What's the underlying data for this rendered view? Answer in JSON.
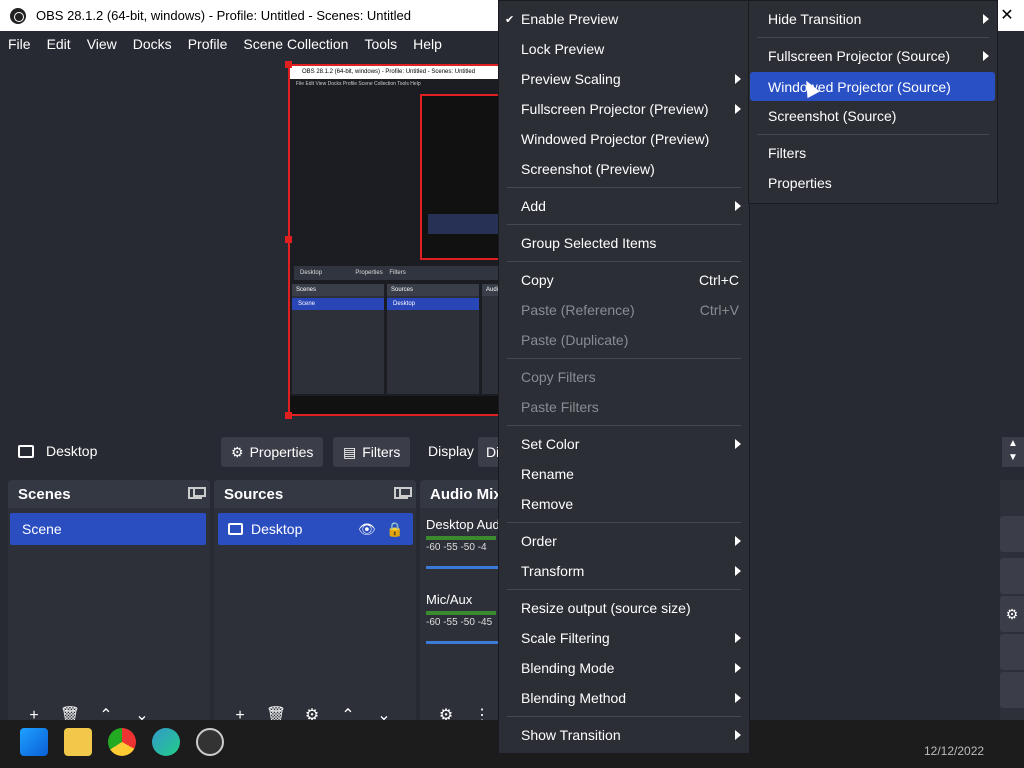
{
  "window": {
    "title": "OBS 28.1.2 (64-bit, windows) - Profile: Untitled - Scenes: Untitled",
    "close": "✕"
  },
  "menubar": [
    "File",
    "Edit",
    "View",
    "Docks",
    "Profile",
    "Scene Collection",
    "Tools",
    "Help"
  ],
  "preview": {
    "nested_title": "OBS 28.1.2 (64-bit, windows) - Profile: Untitled - Scenes: Untitled",
    "nested_menu": "File  Edit  View  Docks  Profile  Scene Collection  Tools  Help",
    "nested_source": "Desktop",
    "nested_properties": "Properties",
    "nested_filters": "Filters",
    "nested_scenes": "Scenes",
    "nested_scene": "Scene",
    "nested_sources": "Sources",
    "nested_desktop": "Desktop",
    "nested_audio": "Audi"
  },
  "sourcebar": {
    "source_name": "Desktop",
    "properties": "Properties",
    "filters": "Filters",
    "display": "Display",
    "display_value": "Di"
  },
  "scenes": {
    "header": "Scenes",
    "items": [
      "Scene"
    ]
  },
  "sources": {
    "header": "Sources",
    "items": [
      "Desktop"
    ]
  },
  "mixer": {
    "header": "Audio Mix",
    "channels": [
      {
        "name": "Desktop Aud",
        "scale": "-60  -55  -50  -4"
      },
      {
        "name": "Mic/Aux",
        "scale": "-60  -55  -50  -45"
      }
    ]
  },
  "taskbar": {
    "clock": "12/12/2022"
  },
  "context_menu": {
    "items": [
      {
        "label": "Enable Preview",
        "checked": true
      },
      {
        "label": "Lock Preview"
      },
      {
        "label": "Preview Scaling",
        "submenu": true
      },
      {
        "label": "Fullscreen Projector (Preview)",
        "submenu": true
      },
      {
        "label": "Windowed Projector (Preview)"
      },
      {
        "label": "Screenshot (Preview)"
      },
      {
        "label": "Add",
        "submenu": true
      },
      {
        "label": "Group Selected Items"
      },
      {
        "label": "Copy",
        "shortcut": "Ctrl+C"
      },
      {
        "label": "Paste (Reference)",
        "shortcut": "Ctrl+V",
        "disabled": true
      },
      {
        "label": "Paste (Duplicate)",
        "disabled": true
      },
      {
        "label": "Copy Filters",
        "disabled": true
      },
      {
        "label": "Paste Filters",
        "disabled": true
      },
      {
        "label": "Set Color",
        "submenu": true
      },
      {
        "label": "Rename"
      },
      {
        "label": "Remove"
      },
      {
        "label": "Order",
        "submenu": true
      },
      {
        "label": "Transform",
        "submenu": true
      },
      {
        "label": "Resize output (source size)"
      },
      {
        "label": "Scale Filtering",
        "submenu": true
      },
      {
        "label": "Blending Mode",
        "submenu": true
      },
      {
        "label": "Blending Method",
        "submenu": true
      },
      {
        "label": "Show Transition",
        "submenu": true
      }
    ]
  },
  "submenu": {
    "items": [
      {
        "label": "Hide Transition",
        "submenu": true
      },
      {
        "label": "Fullscreen Projector (Source)",
        "submenu": true
      },
      {
        "label": "Windowed Projector (Source)",
        "highlighted": true
      },
      {
        "label": "Screenshot (Source)"
      },
      {
        "label": "Filters"
      },
      {
        "label": "Properties"
      }
    ]
  },
  "colors": {
    "accent": "#2a50c6",
    "selection_red": "#e02020",
    "background": "#272a33"
  }
}
